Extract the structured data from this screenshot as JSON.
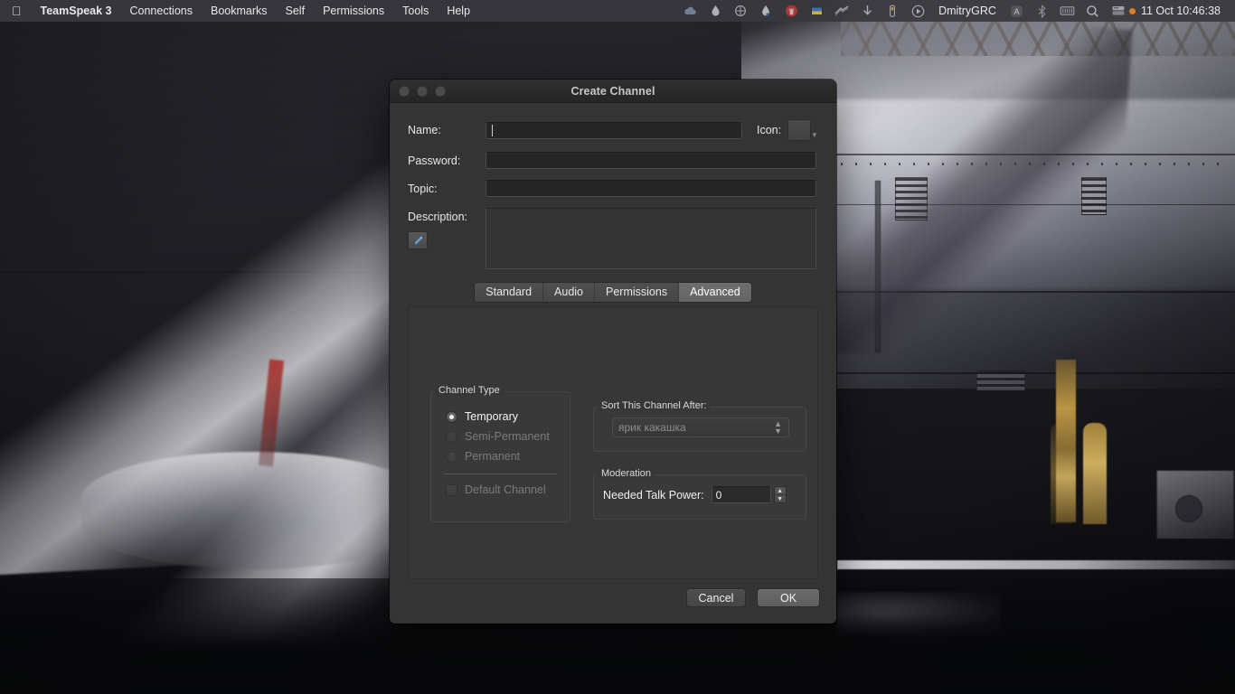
{
  "menubar": {
    "apple_icon": "apple-logo-icon",
    "items": [
      {
        "label": "TeamSpeak 3",
        "bold": true
      },
      {
        "label": "Connections",
        "bold": false
      },
      {
        "label": "Bookmarks",
        "bold": false
      },
      {
        "label": "Self",
        "bold": false
      },
      {
        "label": "Permissions",
        "bold": false
      },
      {
        "label": "Tools",
        "bold": false
      },
      {
        "label": "Help",
        "bold": false
      }
    ],
    "status_icons": [
      "cloud-icon",
      "droplet-icon",
      "thermometer-icon",
      "water-drop-icon",
      "red-trash-icon",
      "flag-icon",
      "wave-icon",
      "download-arrow-icon",
      "battery-icon",
      "play-circle-icon"
    ],
    "user": "DmitryGRC",
    "trailing_icons": [
      "input-source-a-icon",
      "bluetooth-icon",
      "keyboard-icon",
      "search-icon",
      "notification-center-icon"
    ],
    "notification_dot_color": "#e07b22",
    "clock": "11 Oct  10:46:38"
  },
  "dialog": {
    "title": "Create Channel",
    "traffic_lights": [
      "close-button",
      "minimize-button",
      "zoom-button"
    ],
    "fields": {
      "name_label": "Name:",
      "name_value": "",
      "icon_label": "Icon:",
      "icon_button": "icon-picker-button",
      "password_label": "Password:",
      "password_value": "",
      "topic_label": "Topic:",
      "topic_value": "",
      "description_label": "Description:",
      "description_value": "",
      "edit_button_icon": "pencil-icon"
    },
    "tabs": [
      {
        "label": "Standard",
        "active": false
      },
      {
        "label": "Audio",
        "active": false
      },
      {
        "label": "Permissions",
        "active": false
      },
      {
        "label": "Advanced",
        "active": true
      }
    ],
    "channel_type": {
      "group_title": "Channel Type",
      "options": [
        {
          "label": "Temporary",
          "selected": true,
          "disabled": false
        },
        {
          "label": "Semi-Permanent",
          "selected": false,
          "disabled": true
        },
        {
          "label": "Permanent",
          "selected": false,
          "disabled": true
        }
      ],
      "default_channel": {
        "label": "Default Channel",
        "checked": false,
        "disabled": true
      }
    },
    "sort": {
      "group_title": "Sort This Channel After:",
      "selected_value": "ярик какашка",
      "disabled": true
    },
    "moderation": {
      "group_title": "Moderation",
      "talk_power_label": "Needed Talk Power:",
      "talk_power_value": "0"
    },
    "buttons": {
      "cancel": "Cancel",
      "ok": "OK"
    }
  },
  "colors": {
    "dialog_bg": "#343434",
    "titlebar_bg": "#2b2b2b",
    "menubar_bg": "#3a383e",
    "accent_dot": "#e07b22",
    "pencil_blue": "#5f9fd6"
  }
}
